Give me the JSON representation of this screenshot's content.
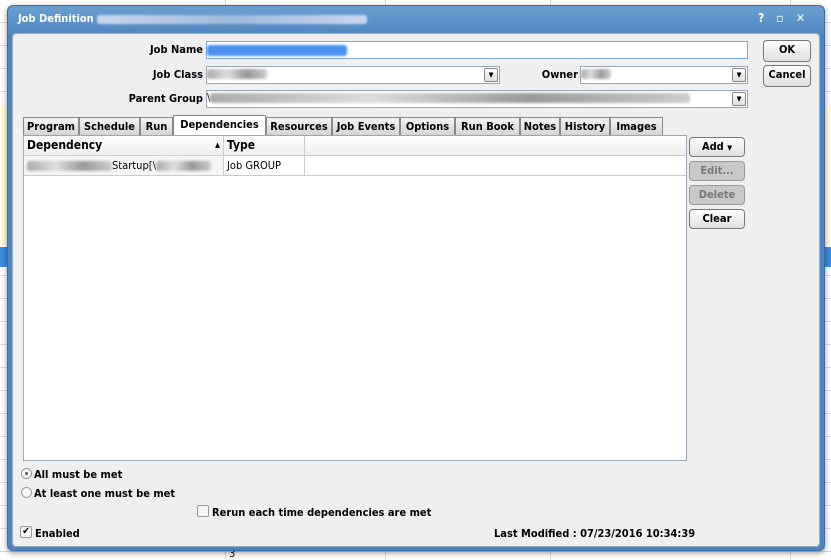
{
  "window": {
    "title": "Job Definition",
    "help": "?",
    "maximize": "▫",
    "close": "✕"
  },
  "form": {
    "job_name_label": "Job Name",
    "job_class_label": "Job Class",
    "owner_label": "Owner",
    "parent_group_label": "Parent Group",
    "parent_group_prefix": "\\"
  },
  "buttons": {
    "ok": "OK",
    "cancel": "Cancel",
    "add": "Add",
    "edit": "Edit...",
    "delete": "Delete",
    "clear": "Clear"
  },
  "tabs": [
    {
      "label": "Program"
    },
    {
      "label": "Schedule"
    },
    {
      "label": "Run"
    },
    {
      "label": "Dependencies",
      "active": true
    },
    {
      "label": "Resources"
    },
    {
      "label": "Job Events"
    },
    {
      "label": "Options"
    },
    {
      "label": "Run Book"
    },
    {
      "label": "Notes"
    },
    {
      "label": "History"
    },
    {
      "label": "Images"
    }
  ],
  "grid": {
    "columns": [
      "Dependency",
      "Type"
    ],
    "rows": [
      {
        "dependency": "Startup[\\",
        "type": "Job GROUP"
      }
    ]
  },
  "options": {
    "all_must_be_met": "All must be met",
    "at_least_one": "At least one must be met",
    "selected": "all_must_be_met",
    "rerun_label": "Rerun each time dependencies are met",
    "rerun_checked": false,
    "enabled_label": "Enabled",
    "enabled_checked": true
  },
  "last_modified": "Last Modified : 07/23/2016 10:34:39",
  "background": {
    "cell_value": "3"
  }
}
